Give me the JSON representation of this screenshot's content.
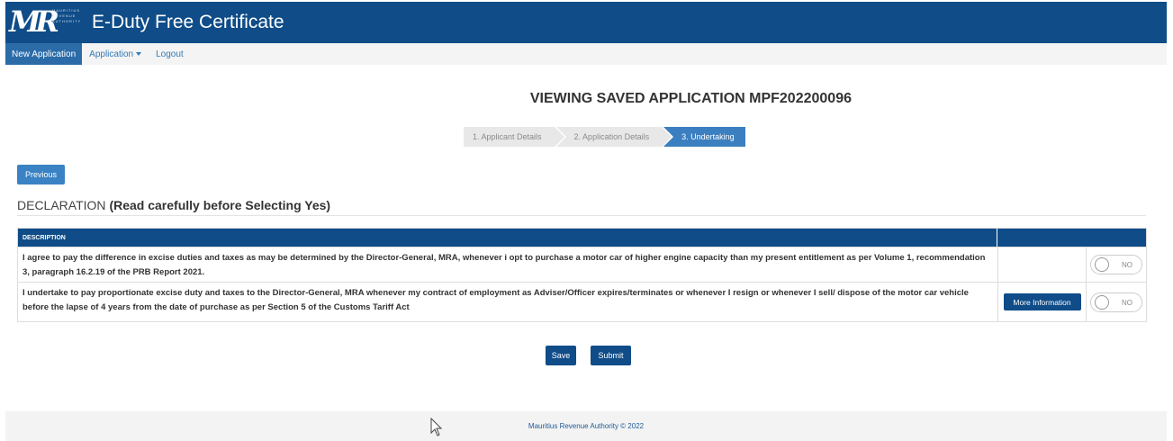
{
  "header": {
    "logo_text": "MR",
    "logo_subtext": "MAURITIUS REVENUE AUTHORITY",
    "app_title": "E-Duty Free Certificate"
  },
  "nav": {
    "new_application": "New Application",
    "application": "Application",
    "logout": "Logout"
  },
  "page": {
    "title": "VIEWING SAVED APPLICATION MPF202200096"
  },
  "steps": [
    "1. Applicant Details",
    "2. Application Details",
    "3. Undertaking"
  ],
  "buttons": {
    "previous": "Previous",
    "save": "Save",
    "submit": "Submit",
    "more_info": "More Information"
  },
  "declaration": {
    "heading_plain": "DECLARATION ",
    "heading_bold": "(Read carefully before Selecting Yes)"
  },
  "table": {
    "column_description": "DESCRIPTION",
    "rows": [
      {
        "text": "I agree to pay the difference in excise duties and taxes as may be determined by the Director-General, MRA, whenever i opt to purchase a motor car of higher engine capacity than my present entitlement as per Volume 1, recommendation 3, paragraph 16.2.19 of the PRB Report 2021.",
        "toggle": "NO"
      },
      {
        "text": "I undertake to pay proportionate excise duty and taxes to the Director-General, MRA whenever my contract of employment as Adviser/Officer expires/terminates or whenever I resign or whenever I sell/ dispose of the motor car vehicle before the lapse of 4 years from the date of purchase as per Section 5 of the Customs Tariff Act",
        "toggle": "NO"
      }
    ]
  },
  "footer": {
    "text": "Mauritius Revenue Authority © 2022"
  },
  "colors": {
    "primary": "#0f4c88",
    "active_step": "#3b7fc0",
    "button": "#3a82c4"
  }
}
